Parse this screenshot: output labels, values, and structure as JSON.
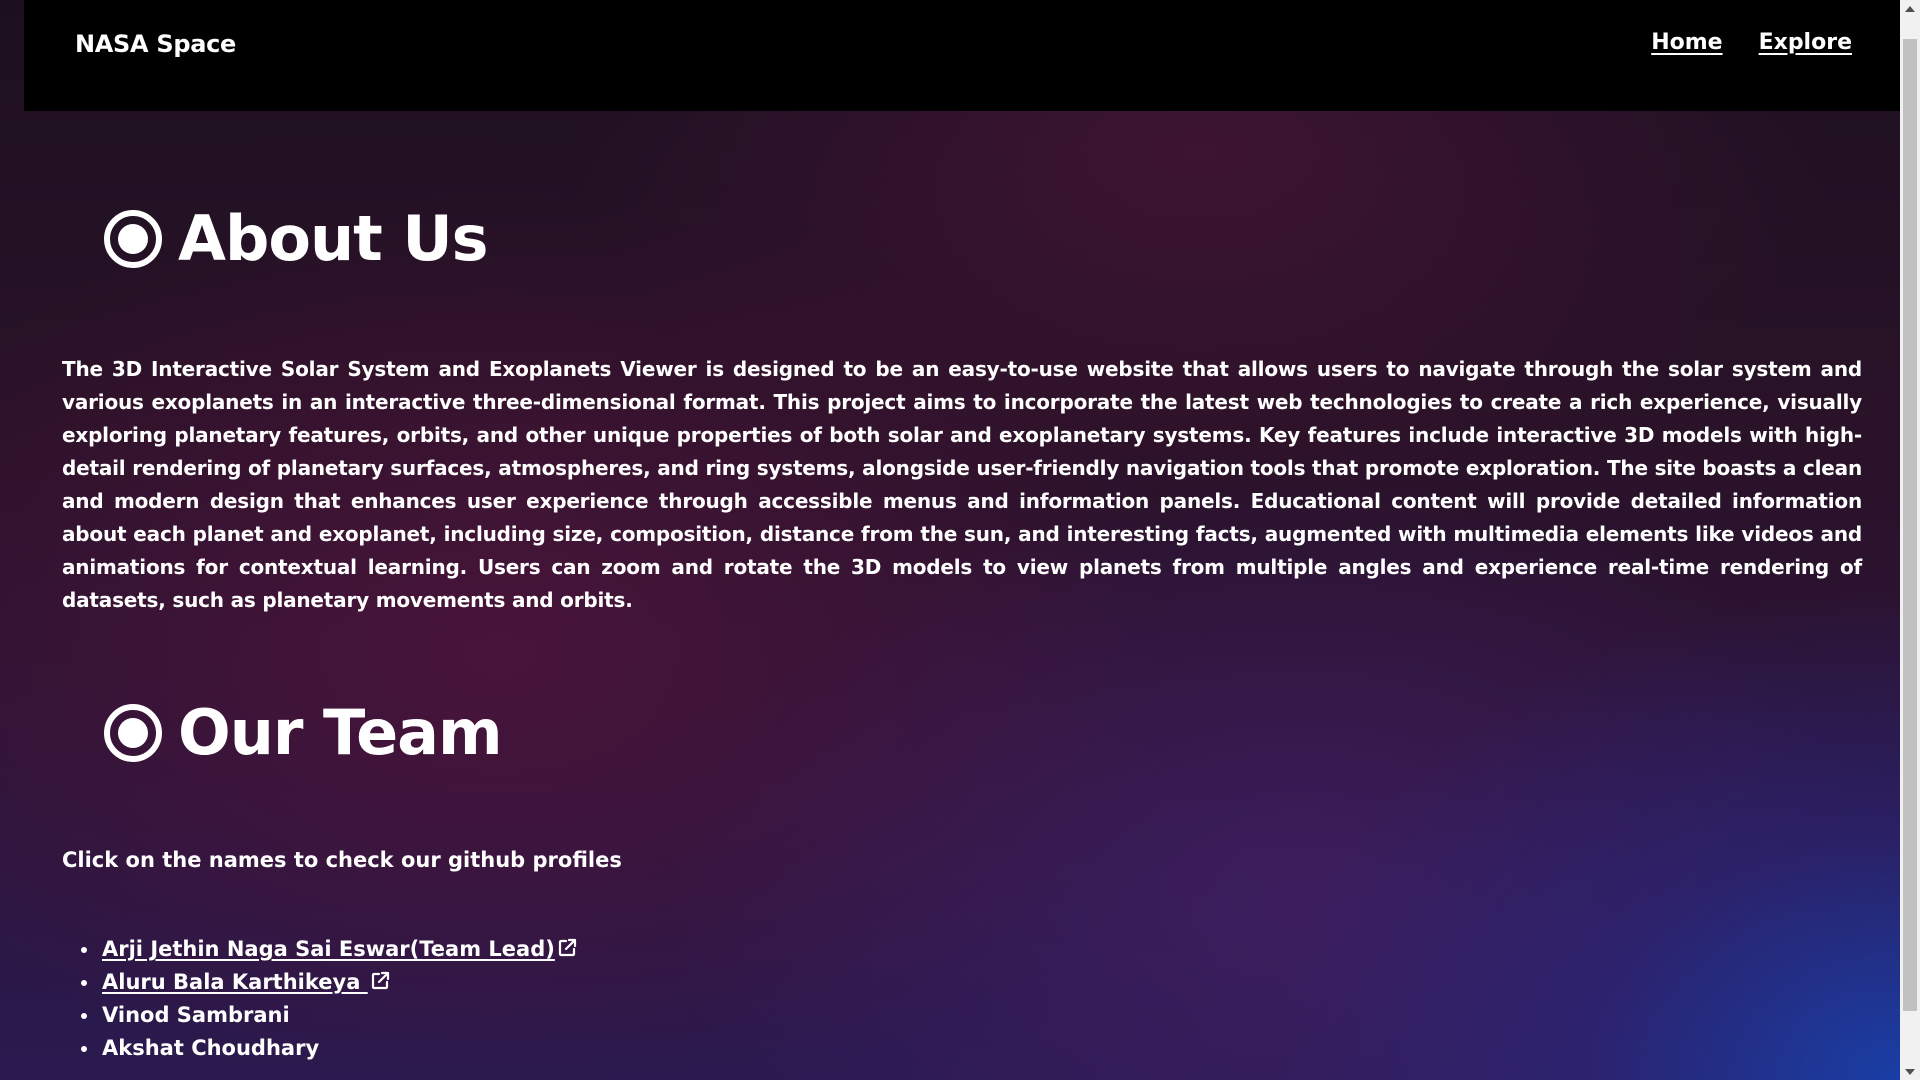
{
  "navbar": {
    "brand": "NASA Space",
    "links": [
      {
        "label": "Home"
      },
      {
        "label": "Explore"
      }
    ]
  },
  "about": {
    "heading": "About Us",
    "text": "The 3D Interactive Solar System and Exoplanets Viewer is designed to be an easy-to-use website that allows users to navigate through the solar system and various exoplanets in an interactive three-dimensional format. This project aims to incorporate the latest web technologies to create a rich experience, visually exploring planetary features, orbits, and other unique properties of both solar and exoplanetary systems. Key features include interactive 3D models with high-detail rendering of planetary surfaces, atmospheres, and ring systems, alongside user-friendly navigation tools that promote exploration. The site boasts a clean and modern design that enhances user experience through accessible menus and information panels. Educational content will provide detailed information about each planet and exoplanet, including size, composition, distance from the sun, and interesting facts, augmented with multimedia elements like videos and animations for contextual learning. Users can zoom and rotate the 3D models to view planets from multiple angles and experience real-time rendering of datasets, such as planetary movements and orbits."
  },
  "team": {
    "heading": "Our Team",
    "intro": "Click on the names to check our github profiles",
    "members": [
      {
        "name": "Arji Jethin Naga Sai Eswar(Team Lead)",
        "linked": true,
        "icon": "external-link-icon"
      },
      {
        "name": "Aluru Bala Karthikeya ",
        "linked": true,
        "icon": "external-link-icon"
      },
      {
        "name": "Vinod Sambrani",
        "linked": false
      },
      {
        "name": "Akshat Choudhary",
        "linked": false
      }
    ]
  },
  "icons": {
    "heading_bullet": "radio-bullet-icon",
    "scroll_up": "scroll-up-arrow-icon",
    "scroll_down": "scroll-down-arrow-icon"
  },
  "colors": {
    "navbar_bg": "#000000",
    "text": "#ffffff",
    "gradient_corner": "#1840aa",
    "gradient_mid": "#52143c"
  }
}
